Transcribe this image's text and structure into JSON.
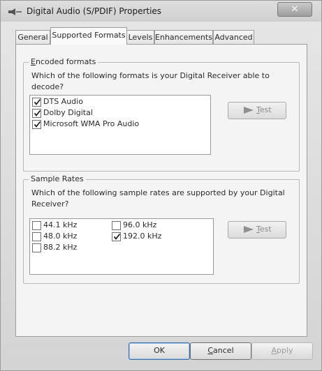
{
  "window": {
    "title": "Digital Audio (S/PDIF) Properties",
    "close_symbol": "✕"
  },
  "tabs": [
    "General",
    "Supported Formats",
    "Levels",
    "Enhancements",
    "Advanced"
  ],
  "active_tab": "Supported Formats",
  "encoded_formats": {
    "legend": "Encoded formats",
    "question": "Which of the following formats is your Digital Receiver able to decode?",
    "items": [
      {
        "label": "DTS Audio",
        "checked": true
      },
      {
        "label": "Dolby Digital",
        "checked": true
      },
      {
        "label": "Microsoft WMA Pro Audio",
        "checked": true
      }
    ],
    "test_label": "Test"
  },
  "sample_rates": {
    "legend": "Sample Rates",
    "question": "Which of the following sample rates are supported by your Digital Receiver?",
    "items": [
      {
        "label": "44.1 kHz",
        "checked": false
      },
      {
        "label": "48.0 kHz",
        "checked": false
      },
      {
        "label": "88.2 kHz",
        "checked": false
      },
      {
        "label": "96.0 kHz",
        "checked": false
      },
      {
        "label": "192.0 kHz",
        "checked": true
      }
    ],
    "test_label": "Test"
  },
  "buttons": {
    "ok": "OK",
    "cancel": "Cancel",
    "apply": "Apply"
  }
}
